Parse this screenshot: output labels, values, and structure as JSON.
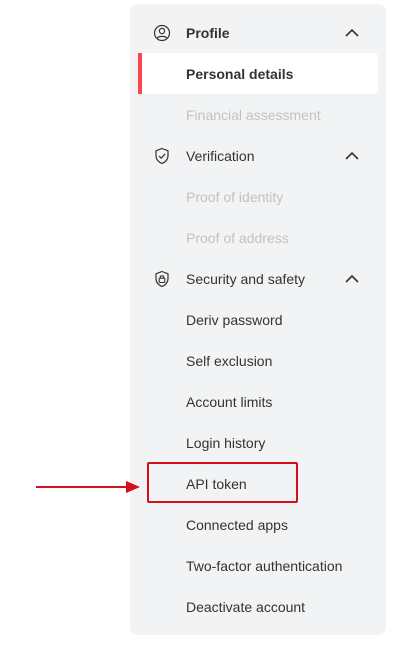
{
  "sidebar": {
    "sections": [
      {
        "id": "profile",
        "label": "Profile",
        "icon": "profile-icon",
        "expanded": true,
        "items": [
          {
            "label": "Personal details",
            "state": "active"
          },
          {
            "label": "Financial assessment",
            "state": "disabled"
          }
        ]
      },
      {
        "id": "verification",
        "label": "Verification",
        "icon": "shield-check-icon",
        "expanded": true,
        "items": [
          {
            "label": "Proof of identity",
            "state": "disabled"
          },
          {
            "label": "Proof of address",
            "state": "disabled"
          }
        ]
      },
      {
        "id": "security",
        "label": "Security and safety",
        "icon": "shield-lock-icon",
        "expanded": true,
        "items": [
          {
            "label": "Deriv password",
            "state": "normal"
          },
          {
            "label": "Self exclusion",
            "state": "normal"
          },
          {
            "label": "Account limits",
            "state": "normal"
          },
          {
            "label": "Login history",
            "state": "normal"
          },
          {
            "label": "API token",
            "state": "highlighted"
          },
          {
            "label": "Connected apps",
            "state": "normal"
          },
          {
            "label": "Two-factor authentication",
            "state": "normal"
          },
          {
            "label": "Deactivate account",
            "state": "normal"
          }
        ]
      }
    ]
  },
  "annotation": {
    "highlight_color": "#d60f1d",
    "arrow_color": "#d60f1d",
    "accent_color": "#ff444f"
  }
}
